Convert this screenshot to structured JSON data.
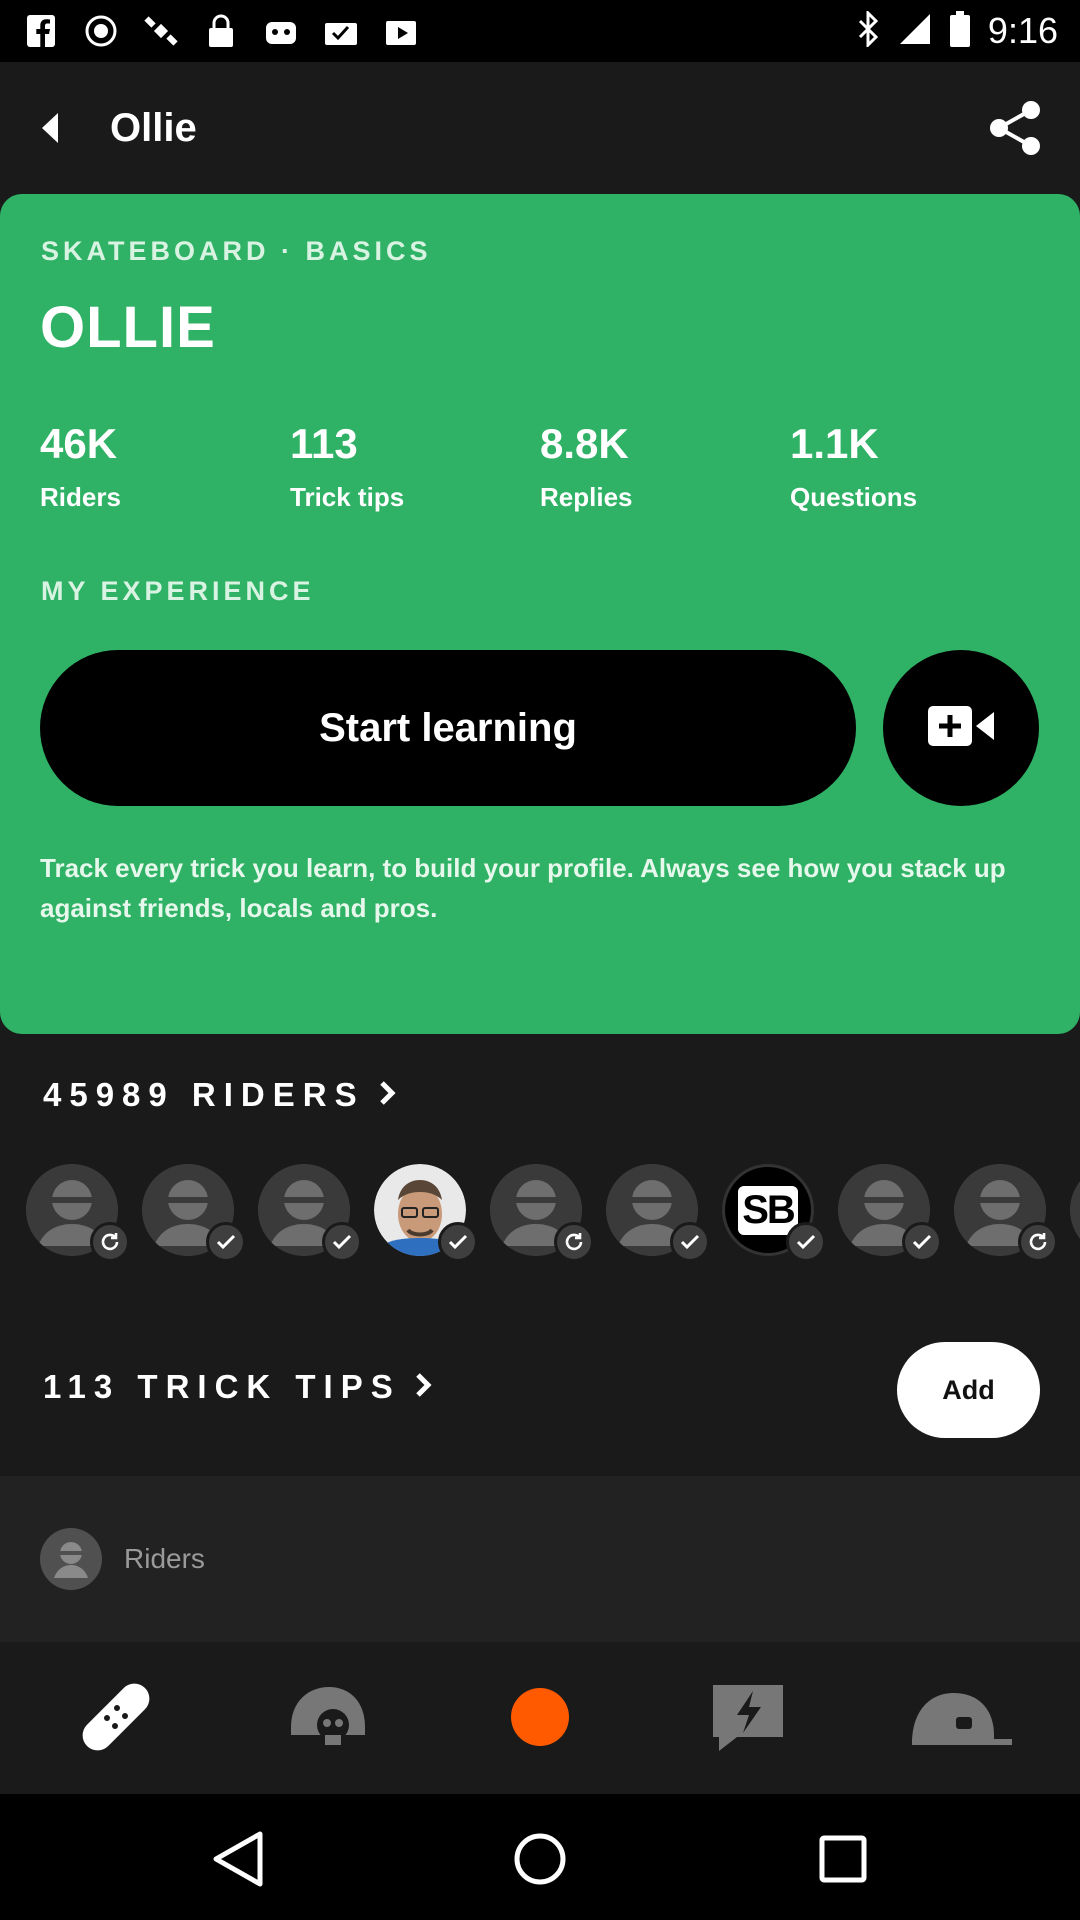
{
  "status_bar": {
    "time": "9:16",
    "icons": [
      "facebook-icon",
      "fake-gps-icon",
      "satellite-icon",
      "lock-icon",
      "robot-icon",
      "checklist-icon",
      "play-store-icon",
      "bluetooth-icon",
      "signal-icon",
      "battery-icon"
    ]
  },
  "header": {
    "title": "Ollie",
    "back_icon": "back-arrow-icon",
    "share_icon": "share-icon"
  },
  "hero": {
    "category": "SKATEBOARD · BASICS",
    "title": "OLLIE",
    "stats": [
      {
        "value": "46K",
        "label": "Riders"
      },
      {
        "value": "113",
        "label": "Trick tips"
      },
      {
        "value": "8.8K",
        "label": "Replies"
      },
      {
        "value": "1.1K",
        "label": "Questions"
      }
    ],
    "section_label": "MY EXPERIENCE",
    "start_button": "Start learning",
    "video_icon": "add-video-icon",
    "description": "Track every trick you learn, to build your profile. Always see how you stack up against friends, locals and pros.",
    "accent_color": "#2fb265"
  },
  "riders": {
    "heading": "45989 RIDERS",
    "avatars": [
      {
        "type": "placeholder",
        "status": "learning"
      },
      {
        "type": "placeholder",
        "status": "landed"
      },
      {
        "type": "placeholder",
        "status": "landed"
      },
      {
        "type": "photo",
        "status": "landed"
      },
      {
        "type": "placeholder",
        "status": "learning"
      },
      {
        "type": "placeholder",
        "status": "landed"
      },
      {
        "type": "logo",
        "text": "SB",
        "status": "landed"
      },
      {
        "type": "placeholder",
        "status": "landed"
      },
      {
        "type": "placeholder",
        "status": "learning"
      },
      {
        "type": "placeholder",
        "status": "landed"
      }
    ]
  },
  "tips": {
    "heading": "113 TRICK TIPS",
    "add_button": "Add"
  },
  "riders_row": {
    "label": "Riders"
  },
  "tab_bar": {
    "tabs": [
      "skateboard-deck-icon",
      "helmet-skull-icon",
      "record-dot-icon",
      "lightning-chat-icon",
      "cap-icon"
    ],
    "record_color": "#ff5a00"
  },
  "nav_bar": {
    "buttons": [
      "nav-back-icon",
      "nav-home-icon",
      "nav-recents-icon"
    ]
  }
}
